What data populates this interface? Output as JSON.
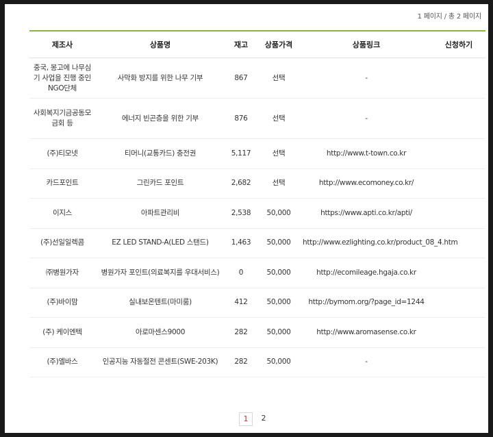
{
  "page_info": "1 페이지 / 총 2 페이지",
  "columns": [
    "제조사",
    "상품명",
    "재고",
    "상품가격",
    "상품링크",
    "신청하기"
  ],
  "rows": [
    {
      "maker": "중국, 몽고에 나무심기 사업을 진행 중인 NGO단체",
      "product": "사막화 방지를 위한 나무 기부",
      "stock": "867",
      "price": "선택",
      "link": "-",
      "apply": ""
    },
    {
      "maker": "사회복지기금공동모금회 등",
      "product": "에너지 빈곤층을 위한 기부",
      "stock": "876",
      "price": "선택",
      "link": "-",
      "apply": ""
    },
    {
      "maker": "(주)티모넷",
      "product": "티머니(교통카드) 충전권",
      "stock": "5,117",
      "price": "선택",
      "link": "http://www.t-town.co.kr",
      "apply": ""
    },
    {
      "maker": "카드포인트",
      "product": "그린카드 포인트",
      "stock": "2,682",
      "price": "선택",
      "link": "http://www.ecomoney.co.kr/",
      "apply": ""
    },
    {
      "maker": "이지스",
      "product": "아파트관리비",
      "stock": "2,538",
      "price": "50,000",
      "link": "https://www.apti.co.kr/apti/",
      "apply": ""
    },
    {
      "maker": "(주)선일일렉콤",
      "product": "EZ LED STAND-A(LED 스탠드)",
      "stock": "1,463",
      "price": "50,000",
      "link": "http://www.ezlighting.co.kr/product_08_4.htm",
      "apply": ""
    },
    {
      "maker": "㈜병원가자",
      "product": "병원가자 포인트(의료복지를 우대서비스)",
      "stock": "0",
      "price": "50,000",
      "link": "http://ecomileage.hgaja.co.kr",
      "apply": ""
    },
    {
      "maker": "(주)바이맘",
      "product": "실내보온텐트(마미룸)",
      "stock": "412",
      "price": "50,000",
      "link": "http://bymom.org/?page_id=1244",
      "apply": ""
    },
    {
      "maker": "(주) 케이엔텍",
      "product": "아로마센스9000",
      "stock": "282",
      "price": "50,000",
      "link": "http://www.aromasense.co.kr",
      "apply": ""
    },
    {
      "maker": "(주)엘바스",
      "product": "인공지능 자동절전 콘센트(SWE-203K)",
      "stock": "282",
      "price": "50,000",
      "link": "-",
      "apply": ""
    }
  ],
  "pagination": {
    "pages": [
      "1",
      "2"
    ],
    "current": "1"
  },
  "colors": {
    "accent_border": "#8cb43c",
    "price_red": "#c0312b",
    "outer_frame": "#1a1a1a"
  }
}
